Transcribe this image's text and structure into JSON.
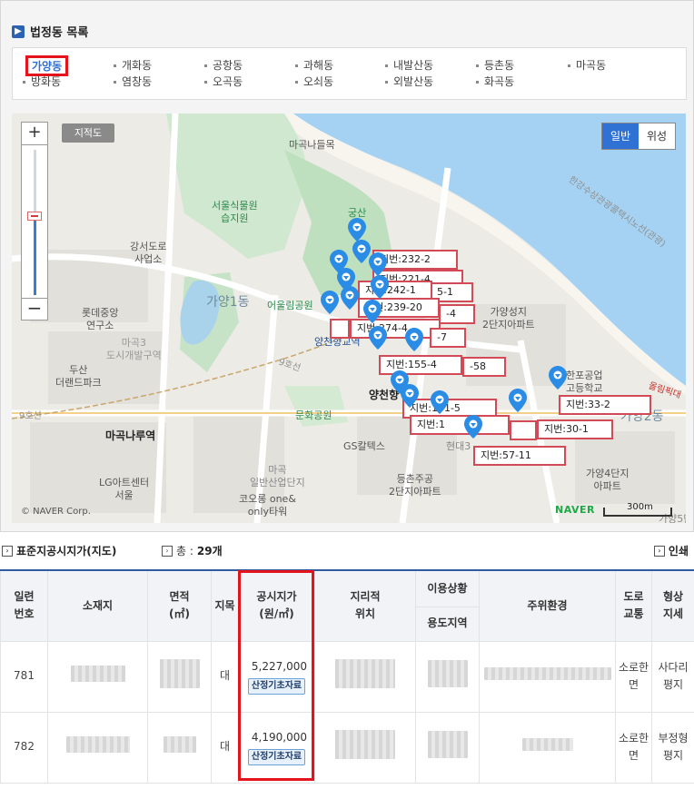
{
  "section_title": "법정동 목록",
  "dongs": [
    "가양동",
    "개화동",
    "공항동",
    "과해동",
    "내발산동",
    "등촌동",
    "마곡동",
    "방화동",
    "염창동",
    "오곡동",
    "오쇠동",
    "외발산동",
    "화곡동"
  ],
  "map": {
    "cadastral_label": "지적도",
    "maptype": {
      "general": "일반",
      "satellite": "위성"
    },
    "zoom_in": "+",
    "zoom_out": "−",
    "labels": {
      "magok_ferry": "마곡나들목",
      "seoul_botanic": "서울식물원\n습지원",
      "gangseo_ro": "강서도로\n사업소",
      "lotte": "롯데중앙\n연구소",
      "magok3": "마곡3\n도시개발구역",
      "doosan": "두산\n더랜드파크",
      "gayang1": "가양1동",
      "eoul": "어울림공원",
      "gungsan": "궁산",
      "yangcheon_hyanggyo": "양천향교역",
      "yangcheon_station": "양천향",
      "munhwa": "문화공원",
      "magoknaru": "마곡나루역",
      "gs": "GS칼텍스",
      "lg": "LG아트센터\n서울",
      "magok_industry": "마곡\n일반산업단지",
      "kolon": "코오롱 one&\nonly타워",
      "deungchon": "등촌주공\n2단지아파트",
      "gayangseongji": "가양성지\n2단지아파트",
      "gayang2": "가양2동",
      "gayang4": "가양4단지\n아파트",
      "hanil": "한포공업\n고등학교",
      "hangang_road": "한강수상관광콜택시노선(관광)",
      "olympic": "올림픽대",
      "line9": "9호선",
      "line9b": "9호선",
      "hyundai": "현대3",
      "naver_corp": "© NAVER Corp.",
      "naver_logo": "NAVER",
      "scale": "300m",
      "gayang5": "가양5단"
    },
    "lots": [
      "지번:232-2",
      "지번:221-4",
      "지번:242-1",
      "지번:239-20",
      "지번:274-4",
      "지번:155-4",
      "지번:131-5",
      "지번:1",
      "지번:30-1",
      "지번:33-2",
      "지번:57-11",
      "-58",
      "-7",
      "-4",
      "5-1"
    ]
  },
  "list": {
    "title": "표준지공시지가(지도)",
    "count_label": "총 :",
    "count_value": "29개",
    "print_label": "인쇄"
  },
  "table": {
    "headers": {
      "serial": "일련\n번호",
      "location": "소재지",
      "area": "면적\n(㎡)",
      "jimok": "지목",
      "price": "공시지가\n(원/㎡)",
      "geo": "지리적\n위치",
      "usage": "이용상황",
      "zone": "용도지역",
      "env": "주위환경",
      "road": "도로\n교통",
      "shape": "형상\n지세"
    },
    "rows": [
      {
        "serial": "781",
        "jimok": "대",
        "price": "5,227,000",
        "btn": "산정기초자료",
        "road": "소로한\n면",
        "shape": "사다리\n평지"
      },
      {
        "serial": "782",
        "jimok": "대",
        "price": "4,190,000",
        "btn": "산정기초자료",
        "road": "소로한\n면",
        "shape": "부정형\n평지"
      }
    ]
  }
}
